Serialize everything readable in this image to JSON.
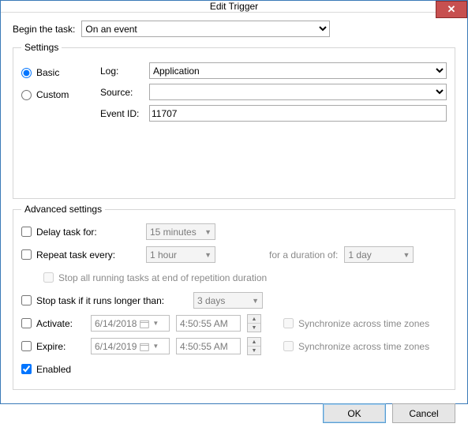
{
  "window": {
    "title": "Edit Trigger",
    "close_glyph": "✕"
  },
  "begin": {
    "label": "Begin the task:",
    "value": "On an event"
  },
  "settings": {
    "legend": "Settings",
    "basic_label": "Basic",
    "custom_label": "Custom",
    "log": {
      "label": "Log:",
      "value": "Application"
    },
    "source": {
      "label": "Source:",
      "value": ""
    },
    "event_id": {
      "label": "Event ID:",
      "value": "11707"
    }
  },
  "advanced": {
    "legend": "Advanced settings",
    "delay": {
      "label": "Delay task for:",
      "value": "15 minutes",
      "checked": false
    },
    "repeat": {
      "label": "Repeat task every:",
      "value": "1 hour",
      "duration_label": "for a duration of:",
      "duration_value": "1 day",
      "checked": false
    },
    "stop_repeat": {
      "label": "Stop all running tasks at end of repetition duration",
      "checked": false
    },
    "stop_longer": {
      "label": "Stop task if it runs longer than:",
      "value": "3 days",
      "checked": false
    },
    "activate": {
      "label": "Activate:",
      "date": "6/14/2018",
      "time": "4:50:55 AM",
      "sync_label": "Synchronize across time zones",
      "checked": false
    },
    "expire": {
      "label": "Expire:",
      "date": "6/14/2019",
      "time": "4:50:55 AM",
      "sync_label": "Synchronize across time zones",
      "checked": false
    },
    "enabled": {
      "label": "Enabled",
      "checked": true
    }
  },
  "buttons": {
    "ok": "OK",
    "cancel": "Cancel"
  }
}
